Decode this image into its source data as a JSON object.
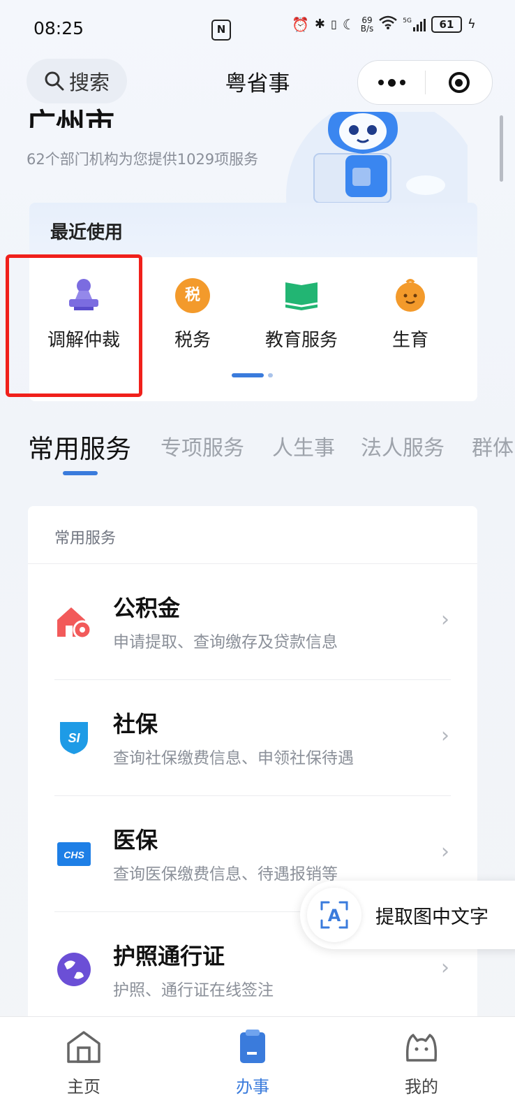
{
  "status_bar": {
    "time": "08:25",
    "nfc_label": "N",
    "net_speed_value": "69",
    "net_speed_unit": "B/s",
    "signal_label": "5G",
    "battery": "61"
  },
  "header": {
    "search_label": "搜索",
    "title": "粤省事"
  },
  "hero": {
    "city": "广州市",
    "subtitle": "62个部门机构为您提供1029项服务"
  },
  "recent": {
    "title": "最近使用",
    "items": [
      {
        "label": "调解仲裁",
        "icon": "mediation-icon"
      },
      {
        "label": "税务",
        "icon": "tax-icon",
        "badge": "税"
      },
      {
        "label": "教育服务",
        "icon": "book-icon"
      },
      {
        "label": "生育",
        "icon": "baby-icon"
      }
    ]
  },
  "tabs": [
    "常用服务",
    "专项服务",
    "人生事",
    "法人服务",
    "群体"
  ],
  "services": {
    "header": "常用服务",
    "items": [
      {
        "title": "公积金",
        "desc": "申请提取、查询缴存及贷款信息",
        "icon": "housing-fund-icon"
      },
      {
        "title": "社保",
        "desc": "查询社保缴费信息、申领社保待遇",
        "icon": "social-security-icon",
        "badge": "SI"
      },
      {
        "title": "医保",
        "desc": "查询医保缴费信息、待遇报销等",
        "icon": "medical-insurance-icon",
        "badge": "CHS"
      },
      {
        "title": "护照通行证",
        "desc": "护照、通行证在线签注",
        "icon": "passport-icon"
      }
    ]
  },
  "ocr": {
    "label": "提取图中文字",
    "icon_letter": "A"
  },
  "bottom_nav": [
    {
      "label": "主页",
      "icon": "home-icon"
    },
    {
      "label": "办事",
      "icon": "tasks-icon"
    },
    {
      "label": "我的",
      "icon": "profile-icon"
    }
  ],
  "colors": {
    "accent": "#3a7bdc",
    "highlight_border": "#f0201b",
    "tax_orange": "#f39a2b",
    "edu_green": "#22b573",
    "mediation_purple": "#7b6ce0"
  }
}
